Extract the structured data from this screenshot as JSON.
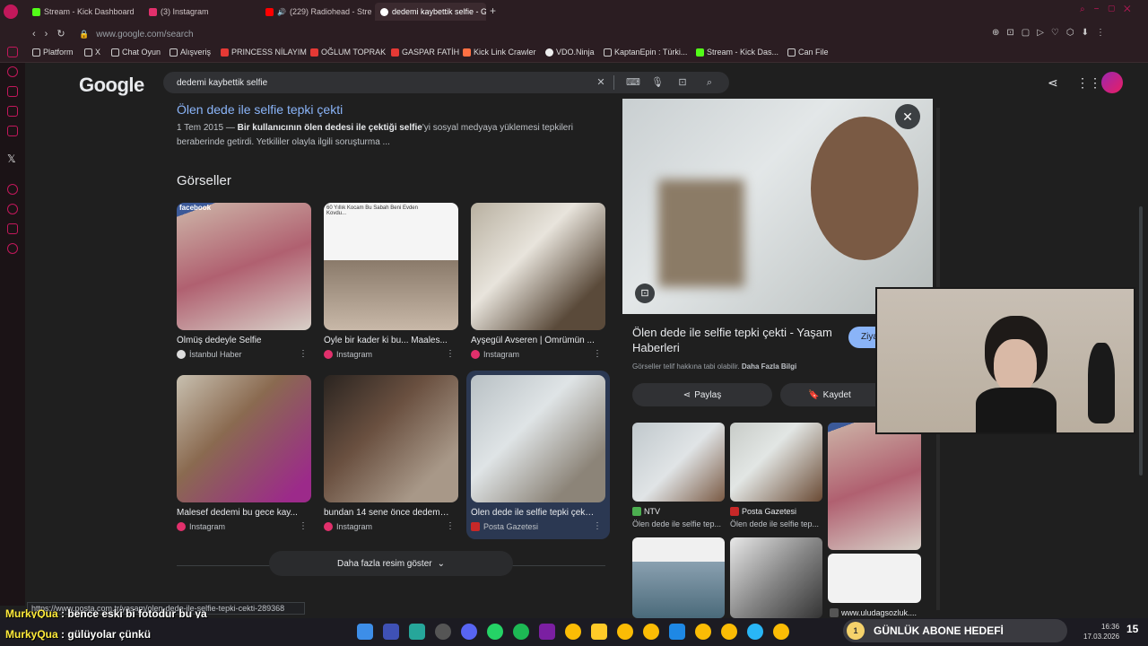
{
  "browser": {
    "tabs": [
      {
        "label": "Stream - Kick Dashboard",
        "color": "#53fc18"
      },
      {
        "label": "(3) Instagram",
        "color": "#e1306c"
      },
      {
        "label": "(229) Radiohead - Stre",
        "color": "#ff0000"
      },
      {
        "label": "dedemi kaybettik selfie - G",
        "color": "#ffffff"
      }
    ],
    "url": "www.google.com/search",
    "bookmarks": [
      "Platform",
      "X",
      "Chat Oyun",
      "Alışveriş",
      "PRINCESS NİLAYIM",
      "OĞLUM TOPRAK",
      "GASPAR FATİH",
      "Kick Link Crawler",
      "VDO.Ninja",
      "KaptanEpin : Türki...",
      "Stream - Kick Das...",
      "Can File"
    ]
  },
  "google": {
    "logo": "Google",
    "query": "dedemi kaybettik selfie",
    "result1": {
      "title": "Ölen dede ile selfie tepki çekti",
      "date": "1 Tem 2015 —",
      "bold": "Bir kullanıcının ölen dedesi ile çektiği selfie",
      "rest": "'yi sosyal medyaya yüklemesi tepkileri beraberinde getirdi. Yetkililer olayla ilgili soruşturma ..."
    },
    "images_heading": "Görseller",
    "images": [
      {
        "caption": "Ölmüş dedeyle Selfie",
        "source": "İstanbul Haber"
      },
      {
        "caption": "Öyle bir kader ki bu... Maales...",
        "source": "Instagram"
      },
      {
        "caption": "Ayşegül Avseren | Ömrümün ...",
        "source": "Instagram"
      },
      {
        "caption": "Malesef dedemi bu gece kay...",
        "source": "Instagram"
      },
      {
        "caption": "bundan 14 sene önce dedemi...",
        "source": "Instagram"
      },
      {
        "caption": "Ölen dede ile selfie tepki çekti...",
        "source": "Posta Gazetesi"
      }
    ],
    "more_button": "Daha fazla resim göster",
    "thumb_text": "facebook",
    "thumb_note": "60 Yıllık Kocam Bu Sabah Beni Evden Kovdu..."
  },
  "panel": {
    "title": "Ölen dede ile selfie tepki çekti - Yaşam Haberleri",
    "visit": "Ziya",
    "note": "Görseller telif hakkına tabi olabilir.",
    "note_link": "Daha Fazla Bilgi",
    "share": "Paylaş",
    "save": "Kaydet",
    "related": [
      {
        "source": "NTV",
        "caption": "Ölen dede ile selfie tep..."
      },
      {
        "source": "Posta Gazetesi",
        "caption": "Ölen dede ile selfie tep..."
      },
      {
        "source": "www.uludagsozluk....",
        "caption": ""
      }
    ]
  },
  "status_url": "https://www.posta.com.tr/yasam/olen-dede-ile-selfie-tepki-cekti-289368",
  "chat": [
    {
      "user": "MurkyQua",
      "msg": "bence eski bi fotodur bu ya"
    },
    {
      "user": "MurkyQua",
      "msg": "gülüyolar çünkü"
    }
  ],
  "overlay": {
    "label": "GÜNLÜK ABONE HEDEFİ",
    "count": "1",
    "count_right": "15"
  },
  "clock": {
    "time": "16:36",
    "date": "17.03.2026"
  }
}
